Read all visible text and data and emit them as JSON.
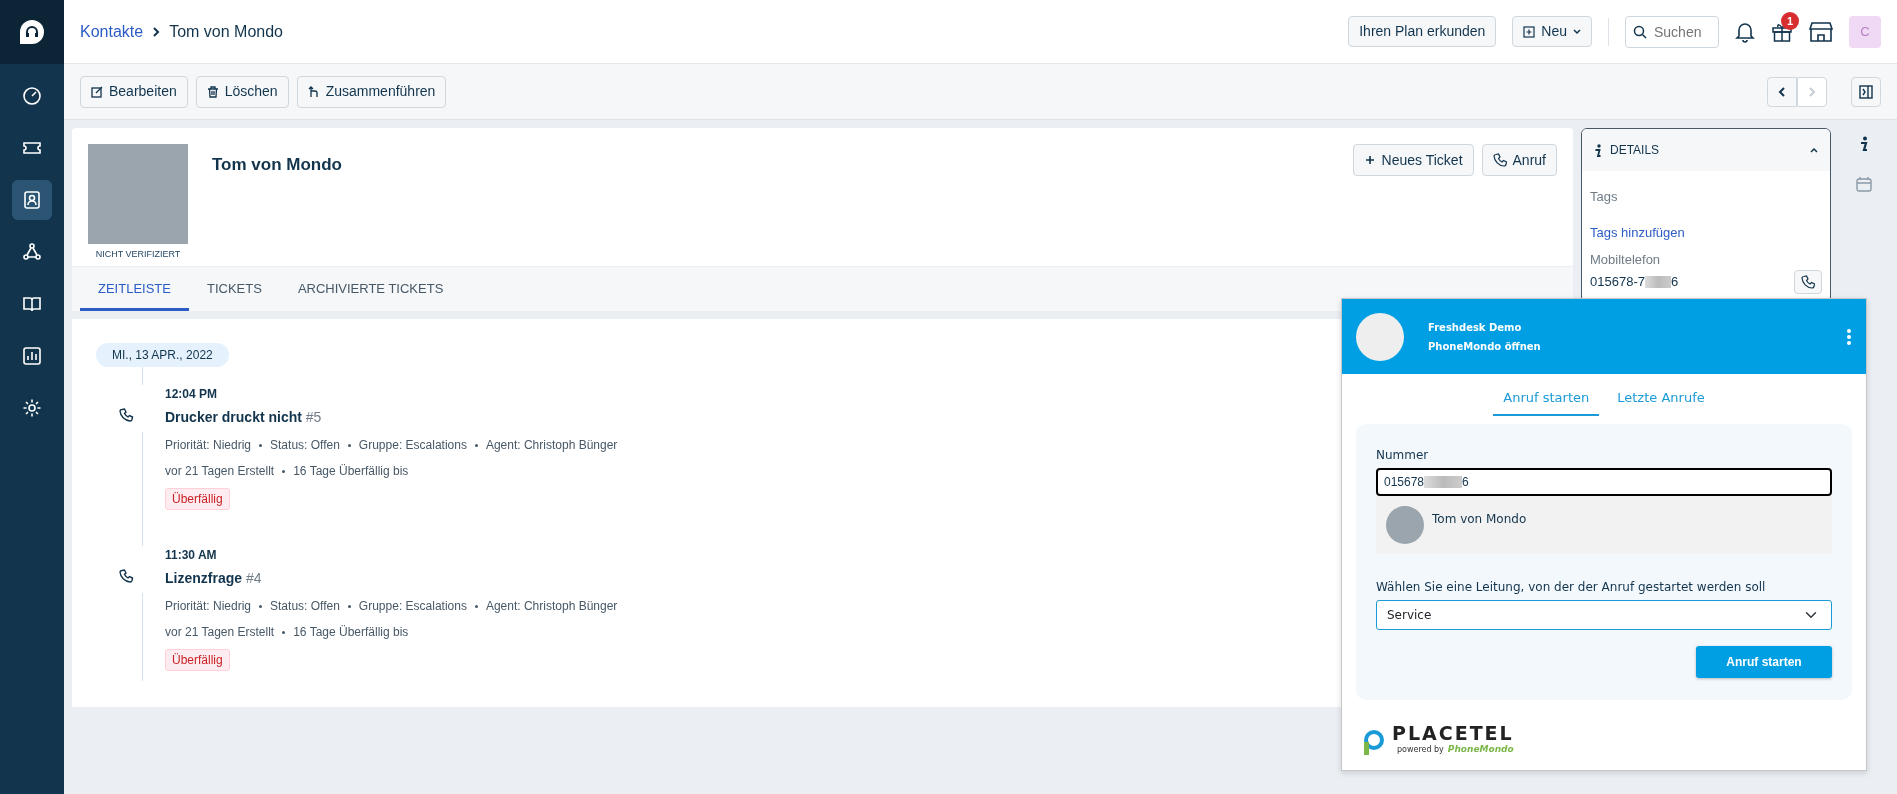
{
  "sidebar": {
    "items": [
      {
        "kind": "dashboard",
        "selected": false
      },
      {
        "kind": "tickets",
        "selected": false
      },
      {
        "kind": "contacts",
        "selected": true
      },
      {
        "kind": "social",
        "selected": false
      },
      {
        "kind": "knowledge",
        "selected": false
      },
      {
        "kind": "reports",
        "selected": false
      },
      {
        "kind": "settings",
        "selected": false
      }
    ]
  },
  "header": {
    "breadcrumb": {
      "parent": "Kontakte",
      "current": "Tom von Mondo"
    },
    "plan_button": "Ihren Plan erkunden",
    "new_button": "Neu",
    "search": {
      "placeholder": "Suchen"
    },
    "gift_badge": "1",
    "avatar": "C"
  },
  "toolbar": {
    "buttons": [
      {
        "kind": "edit",
        "label": "Bearbeiten"
      },
      {
        "kind": "delete",
        "label": "Löschen"
      },
      {
        "kind": "merge",
        "label": "Zusammenführen"
      }
    ]
  },
  "contact": {
    "name": "Tom von Mondo",
    "verification": "NICHT VERIFIZIERT",
    "actions": [
      {
        "kind": "plus",
        "label": "Neues Ticket"
      },
      {
        "kind": "phone",
        "label": "Anruf"
      }
    ]
  },
  "tabs": [
    {
      "label": "ZEITLEISTE",
      "selected": true
    },
    {
      "label": "TICKETS",
      "selected": false
    },
    {
      "label": "ARCHIVIERTE TICKETS",
      "selected": false
    }
  ],
  "timeline": {
    "date": "MI., 13 APR., 2022",
    "entries": [
      {
        "time": "12:04 PM",
        "title": "Drucker druckt nicht",
        "number": "#5",
        "meta": [
          "Priorität: Niedrig",
          "Status: Offen",
          "Gruppe: Escalations",
          "Agent: Christoph Bünger"
        ],
        "dates": [
          "vor 21 Tagen Erstellt",
          "16 Tage Überfällig bis"
        ],
        "tag": "Überfällig"
      },
      {
        "time": "11:30 AM",
        "title": "Lizenzfrage",
        "number": "#4",
        "meta": [
          "Priorität: Niedrig",
          "Status: Offen",
          "Gruppe: Escalations",
          "Agent: Christoph Bünger"
        ],
        "dates": [
          "vor 21 Tagen Erstellt",
          "16 Tage Überfällig bis"
        ],
        "tag": "Überfällig"
      }
    ]
  },
  "details": {
    "title": "DETAILS",
    "expanded": true,
    "tags_label": "Tags",
    "tags_link": "Tags hinzufügen",
    "phone_label": "Mobiltelefon",
    "phone_start": "015678-7",
    "phone_end": "6"
  },
  "dialer": {
    "account": "Freshdesk Demo",
    "open_link": "PhoneMondo öffnen",
    "tabs": [
      {
        "label": "Anruf starten",
        "selected": true
      },
      {
        "label": "Letzte Anrufe",
        "selected": false
      }
    ],
    "number_label": "Nummer",
    "number_start": "015678",
    "number_end": "6",
    "suggestion": "Tom von Mondo",
    "line_label": "Wählen Sie eine Leitung, von der der Anruf gestartet werden soll",
    "line_value": "Service",
    "call_button": "Anruf starten",
    "logo": "PLACETEL",
    "powered_by": "powered by",
    "powered_brand": "PhoneMondo"
  }
}
